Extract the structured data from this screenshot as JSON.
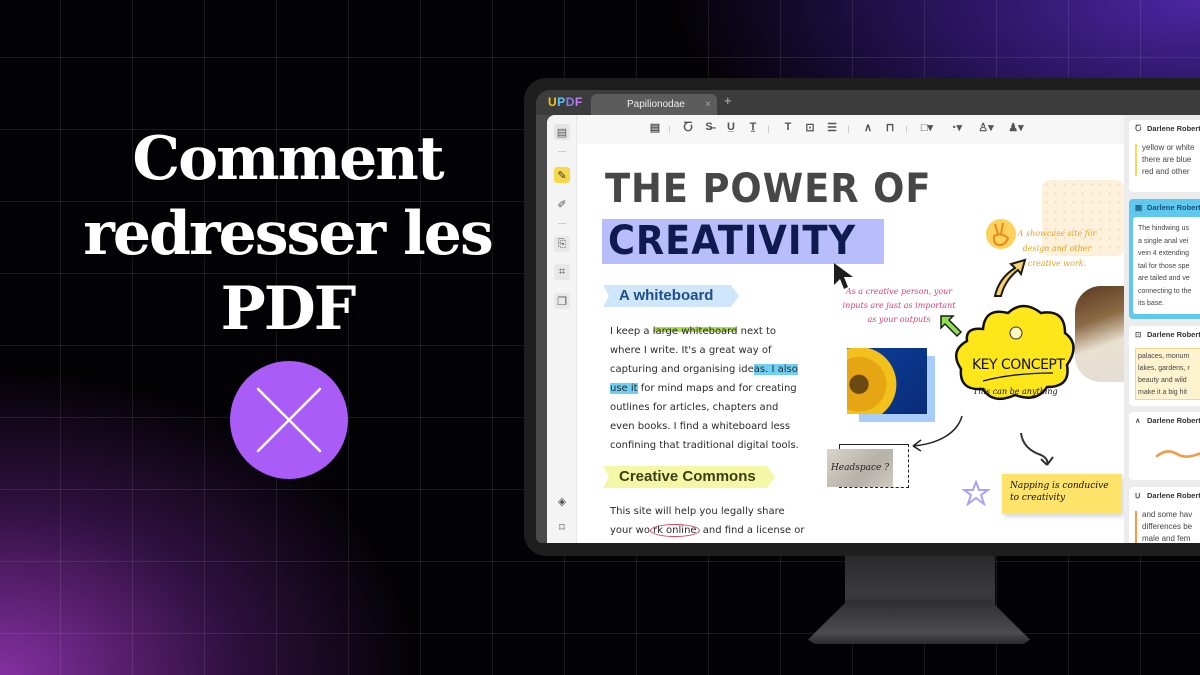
{
  "hero": {
    "headline_lines": [
      "Comment",
      "redresser les",
      "PDF"
    ],
    "badge_icon": "close-x-icon",
    "accent_color": "#a95cf6"
  },
  "app": {
    "logo": [
      "U",
      "P",
      "D",
      "F"
    ],
    "tab": {
      "title": "Papilionodae",
      "close": "×",
      "add": "+"
    },
    "toolbar": [
      {
        "icon": "comment-icon",
        "glyph": "▤"
      },
      {
        "icon": "highlight-icon",
        "glyph": "Ⴀ"
      },
      {
        "icon": "strikethrough-icon",
        "glyph": "S̶"
      },
      {
        "icon": "underline-icon",
        "glyph": "U̲"
      },
      {
        "icon": "squiggly-underline-icon",
        "glyph": "T̰"
      },
      {
        "icon": "text-icon",
        "glyph": "T"
      },
      {
        "icon": "text-box-icon",
        "glyph": "⊡"
      },
      {
        "icon": "text-callout-icon",
        "glyph": "☰"
      },
      {
        "icon": "pencil-icon",
        "glyph": "∧"
      },
      {
        "icon": "eraser-icon",
        "glyph": "⊓"
      },
      {
        "icon": "shape-icon",
        "glyph": "□▾"
      },
      {
        "icon": "sticker-icon",
        "glyph": "◔▾"
      },
      {
        "icon": "stamp-icon",
        "glyph": "♙▾"
      },
      {
        "icon": "signature-icon",
        "glyph": "♟▾"
      }
    ],
    "leftbar": [
      {
        "icon": "reader-icon",
        "glyph": "▤"
      },
      {
        "icon": "comment-mode-icon",
        "glyph": "✎",
        "active": true
      },
      {
        "icon": "edit-pdf-icon",
        "glyph": "✐"
      },
      {
        "icon": "organize-pages-icon",
        "glyph": "⎘"
      },
      {
        "icon": "crop-icon",
        "glyph": "⌗"
      },
      {
        "icon": "watermark-icon",
        "glyph": "❐"
      },
      {
        "icon": "layers-icon",
        "glyph": "◈"
      },
      {
        "icon": "bookmark-icon",
        "glyph": "⌑"
      }
    ]
  },
  "document": {
    "title_line1": "THE POWER OF",
    "title_line2": "CREATIVITY",
    "section1": {
      "heading": "A whiteboard",
      "text_parts": [
        "I keep a ",
        "large whiteboard",
        " next to where I write. It's a great way of capturing and organising ide",
        "as. I also use it",
        " for mind maps and for creating outlines for articles, chapters and even books. I find a whiteboard less confining that traditional digital tools."
      ]
    },
    "section2": {
      "heading": "Creative Commons",
      "text_parts": [
        "This site will help you legally share your wo",
        "rk online",
        " and find a license or"
      ]
    },
    "pink_note": "As a creative person, your inputs are just as important as your outputs",
    "orange_note": "A showcase site for design and other creative work.",
    "key_concept": {
      "title": "KEY CONCEPT",
      "subtitle": "This can be anything"
    },
    "headspace": "Headspace ?",
    "sticky_note": "Napping is conducive to creativity"
  },
  "comments": [
    {
      "author": "Darlene Robertson",
      "type_icon": "highlight-icon",
      "glyph": "Ⴀ",
      "lines": [
        "yellow or white",
        "there are blue",
        "red and other"
      ],
      "bar_color": "#f3d95c"
    },
    {
      "author": "Darlene Robertson",
      "type_icon": "comment-icon",
      "glyph": "▤",
      "selected": true,
      "lines": [
        "The hindwing us",
        "a single anal vei",
        "vein 4 extending",
        "tail for those spe",
        "are tailed and ve",
        "connecting to the",
        "its base."
      ]
    },
    {
      "author": "Darlene Robertson",
      "type_icon": "text-box-icon",
      "glyph": "⊡",
      "lines": [
        "palaces, monum",
        "lakes, gardens, r",
        "beauty and wild",
        "make it a big hit"
      ]
    },
    {
      "author": "Darlene Robertson",
      "type_icon": "pencil-icon",
      "glyph": "∧",
      "lines": []
    },
    {
      "author": "Darlene Robertson",
      "type_icon": "underline-icon",
      "glyph": "U̲",
      "lines": [
        "and some hav",
        "differences be",
        "male and fem"
      ],
      "bar_color": "#f29a44"
    }
  ]
}
